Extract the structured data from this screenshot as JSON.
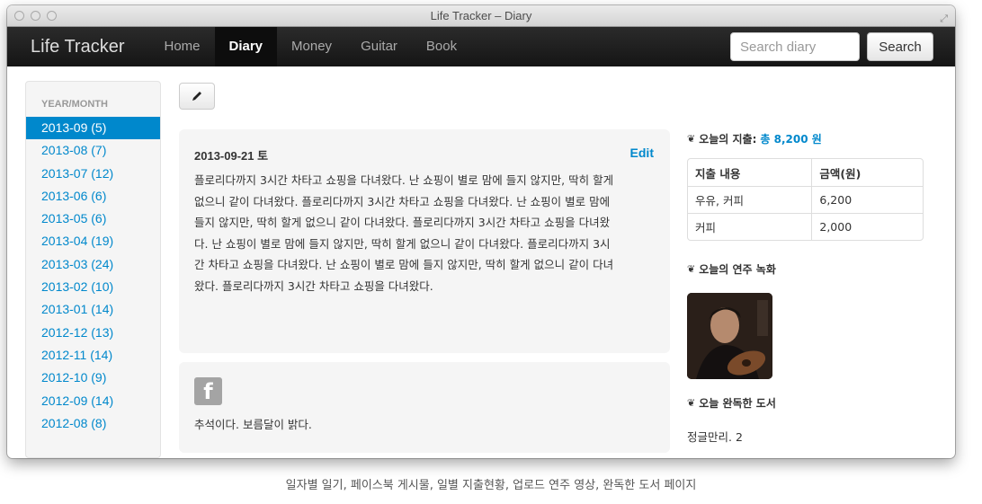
{
  "window": {
    "title": "Life Tracker – Diary"
  },
  "navbar": {
    "brand": "Life Tracker",
    "items": [
      {
        "label": "Home",
        "active": false
      },
      {
        "label": "Diary",
        "active": true
      },
      {
        "label": "Money",
        "active": false
      },
      {
        "label": "Guitar",
        "active": false
      },
      {
        "label": "Book",
        "active": false
      }
    ],
    "search_placeholder": "Search diary",
    "search_button": "Search"
  },
  "sidebar": {
    "header": "YEAR/MONTH",
    "items": [
      "2013-09 (5)",
      "2013-08 (7)",
      "2013-07 (12)",
      "2013-06 (6)",
      "2013-05 (6)",
      "2013-04 (19)",
      "2013-03 (24)",
      "2013-02 (10)",
      "2013-01 (14)",
      "2012-12 (13)",
      "2012-11 (14)",
      "2012-10 (9)",
      "2012-09 (14)",
      "2012-08 (8)"
    ],
    "active_index": 0
  },
  "toolbar": {
    "edit_icon": "pencil-icon"
  },
  "entry": {
    "date": "2013-09-21 토",
    "edit_label": "Edit",
    "lines": [
      "플로리다까지 3시간 차타고 쇼핑을 다녀왔다. 난 쇼핑이 별로 맘에 들지 않지만, 딱히 할게",
      "없으니 같이 다녀왔다.  플로리다까지 3시간 차타고 쇼핑을 다녀왔다. 난 쇼핑이 별로 맘에",
      "들지 않지만, 딱히 할게 없으니 같이 다녀왔다. 플로리다까지 3시간 차타고 쇼핑을 다녀왔",
      "다. 난 쇼핑이 별로 맘에 들지 않지만, 딱히 할게 없으니 같이 다녀왔다.  플로리다까지 3시",
      "간 차타고 쇼핑을 다녀왔다. 난 쇼핑이 별로 맘에 들지 않지만, 딱히 할게 없으니 같이 다녀",
      "왔다.  플로리다까지 3시간 차타고 쇼핑을 다녀왔다."
    ]
  },
  "facebook_post": {
    "icon": "facebook-icon",
    "icon_glyph": "f",
    "text": "추석이다. 보름달이 밝다."
  },
  "expenses": {
    "title": "오늘의 지출:",
    "total": "총 8,200 원",
    "columns": [
      "지출 내용",
      "금액(원)"
    ],
    "rows": [
      [
        "우유, 커피",
        "6,200"
      ],
      [
        "커피",
        "2,000"
      ]
    ]
  },
  "performance": {
    "title": "오늘의 연주 녹화"
  },
  "books": {
    "title": "오늘 완독한 도서",
    "item": "정글만리. 2"
  },
  "caption": "일자별 일기, 페이스북 게시물, 일별 지출현황, 업로드 연주 영상, 완독한 도서 페이지",
  "colors": {
    "accent": "#0088cc",
    "navbar": "#1b1b1b",
    "card": "#f5f5f5"
  }
}
